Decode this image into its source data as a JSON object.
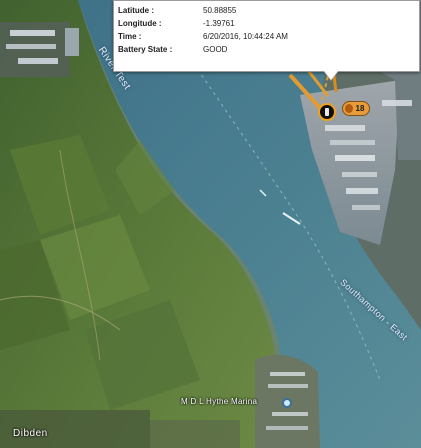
{
  "popup": {
    "rows": [
      {
        "label": "Latitude :",
        "value": "50.88855"
      },
      {
        "label": "Longitude :",
        "value": "-1.39761"
      },
      {
        "label": "Time :",
        "value": "6/20/2016, 10:44:24 AM"
      },
      {
        "label": "Battery State :",
        "value": "GOOD"
      }
    ]
  },
  "map": {
    "labels": {
      "river": "River Test",
      "southampton": "Southampton - East",
      "marina": "M D L Hythe Marina",
      "dibden": "Dibden"
    },
    "marker": {
      "icon": "tracker-marker-icon",
      "badge": "18",
      "color": "#f0a21c"
    },
    "colors": {
      "water": "#4d7f8f",
      "land": "#3f5f2f",
      "field": "#6f8a46",
      "port": "#8e9aa1"
    }
  }
}
